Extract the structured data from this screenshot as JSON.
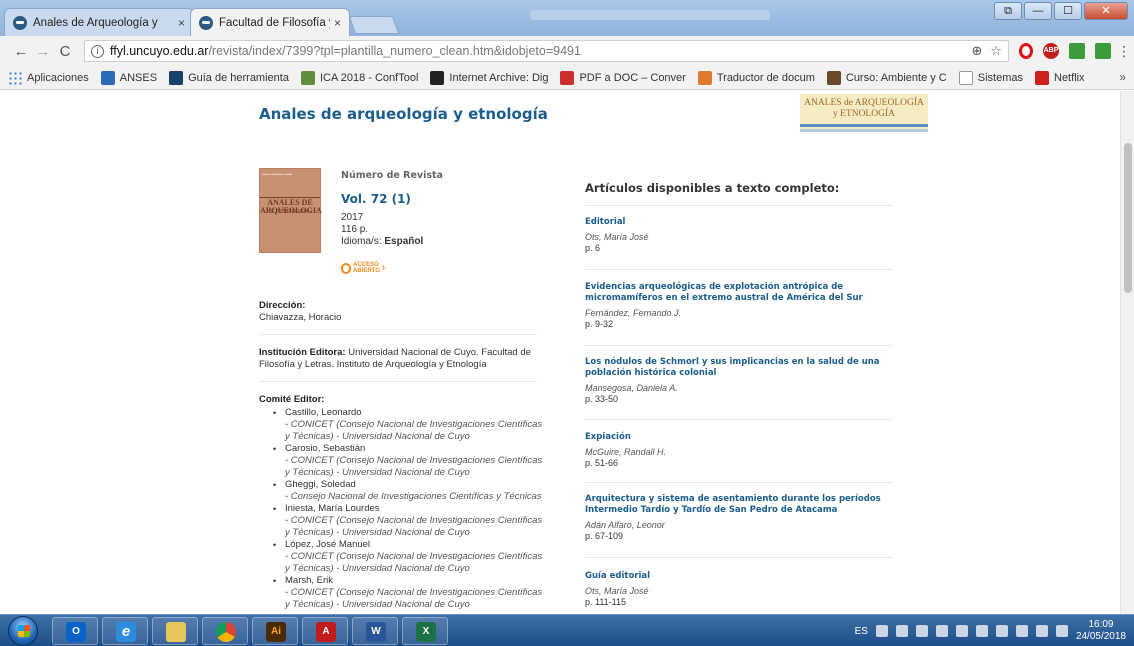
{
  "browser": {
    "tabs": [
      {
        "label": "Anales de Arqueología y",
        "close": "×",
        "active": false
      },
      {
        "label": "Facultad de Filosofía y Le",
        "close": "×",
        "active": true
      }
    ],
    "window_buttons": {
      "restore": "⧉",
      "minimize": "—",
      "maximize": "☐",
      "close": "✕"
    },
    "nav": {
      "back": "←",
      "forward": "→",
      "reload": "C"
    },
    "url_host": "ffyl.uncuyo.edu.ar",
    "url_path": "/revista/index/7399?tpl=plantilla_numero_clean.htm&idobjeto=9491",
    "omnibox_icons": {
      "zoom": "⊕",
      "star": "☆"
    },
    "bookmarks": [
      {
        "label": "Aplicaciones",
        "color": "#3a7bd5"
      },
      {
        "label": "ANSES",
        "color": "#2a6bb8"
      },
      {
        "label": "Guía de herramienta",
        "color": "#1b3f6b"
      },
      {
        "label": "ICA 2018 - ConfTool",
        "color": "#5f8f3a"
      },
      {
        "label": "Internet Archive: Dig",
        "color": "#222222"
      },
      {
        "label": "PDF a DOC – Conver",
        "color": "#cc2e2e"
      },
      {
        "label": "Traductor de docum",
        "color": "#e07a2e"
      },
      {
        "label": "Curso: Ambiente y C",
        "color": "#6a4a2a"
      },
      {
        "label": "Sistemas",
        "color": "#9a9a9a"
      },
      {
        "label": "Netflix",
        "color": "#d01f1f"
      }
    ],
    "bookmarks_more": "»"
  },
  "page": {
    "site_title": "Anales de arqueología y etnología",
    "logo_lines": [
      "ANALES de ARQUEOLOGÍA",
      "y ETNOLOGÍA"
    ],
    "cover_lines": [
      "ANALES DE",
      "ARQUEOLOGIA",
      "Y ETNOLOGIA"
    ],
    "issue": {
      "kicker": "Número de Revista",
      "volume": "Vol. 72 (1)",
      "year": "2017",
      "pages": "116 p.",
      "language_label": "Idioma/s: ",
      "language_value": "Español",
      "open_access": [
        "ACCESO",
        "ABIERTO"
      ]
    },
    "direccion": {
      "label": "Dirección:",
      "value": "Chiavazza, Horacio"
    },
    "institucion": {
      "label": "Institución Editora:",
      "value": " Universidad Nacional de Cuyo. Facultad de Filosofía y Letras. Instituto de Arqueología y Etnología"
    },
    "comite": {
      "label": "Comité Editor:",
      "members": [
        {
          "name": "Castillo, Leonardo",
          "aff": "- CONICET (Consejo Nacional de Investigaciones Científicas y Técnicas) - Universidad Nacional de Cuyo"
        },
        {
          "name": "Carosio, Sebastián",
          "aff": "- CONICET (Consejo Nacional de Investigaciones Científicas y Técnicas) - Universidad Nacional de Cuyo"
        },
        {
          "name": "Gheggi, Soledad",
          "aff": "- Consejo Nacional de Investigaciones Científicas y Técnicas"
        },
        {
          "name": "Iniesta, María Lourdes",
          "aff": "- CONICET (Consejo Nacional de Investigaciones Científicas y Técnicas) - Universidad Nacional de Cuyo"
        },
        {
          "name": "López, José Manuel",
          "aff": "- CONICET (Consejo Nacional de Investigaciones Científicas y Técnicas) - Universidad Nacional de Cuyo"
        },
        {
          "name": "Marsh, Erik",
          "aff": "- CONICET (Consejo Nacional de Investigaciones Científicas y Técnicas) - Universidad Nacional de Cuyo"
        }
      ]
    },
    "articles_heading": "Artículos disponibles a texto completo:",
    "articles": [
      {
        "title": "Editorial",
        "author": "Ots, María José",
        "pages": "p. 6"
      },
      {
        "title": "Evidencias arqueológicas de explotación antrópica de micromamíferos en el extremo austral de América del Sur",
        "author": "Fernández, Fernando J.",
        "pages": "p. 9-32"
      },
      {
        "title": "Los nódulos de Schmorl y sus implicancias en la salud de una población histórica colonial",
        "author": "Mansegosa, Daniela A.",
        "pages": "p. 33-50"
      },
      {
        "title": "Expiación",
        "author": "McGuire, Randall H.",
        "pages": "p. 51-66"
      },
      {
        "title": "Arquitectura y sistema de asentamiento durante los períodos Intermedio Tardío y Tardío de San Pedro de Atacama",
        "author": "Adán Alfaro, Leonor",
        "pages": "p. 67-109"
      },
      {
        "title": "Guía editorial",
        "author": "Ots, María José",
        "pages": "p. 111-115"
      }
    ]
  },
  "taskbar": {
    "apps": [
      {
        "name": "outlook",
        "glyph": "O",
        "color": "#0a64c8"
      },
      {
        "name": "internet-explorer",
        "glyph": "e",
        "color": "#2b8ce0"
      },
      {
        "name": "file-explorer",
        "glyph": "",
        "color": "#e8c55a"
      },
      {
        "name": "chrome",
        "glyph": "",
        "color": "#db4437"
      },
      {
        "name": "illustrator",
        "glyph": "Ai",
        "color": "#4d2a06"
      },
      {
        "name": "acrobat",
        "glyph": "A",
        "color": "#c31b1b"
      },
      {
        "name": "word",
        "glyph": "W",
        "color": "#2a5699"
      },
      {
        "name": "excel",
        "glyph": "X",
        "color": "#1e7145"
      }
    ],
    "lang": "ES",
    "time": "16:09",
    "date": "24/05/2018"
  }
}
